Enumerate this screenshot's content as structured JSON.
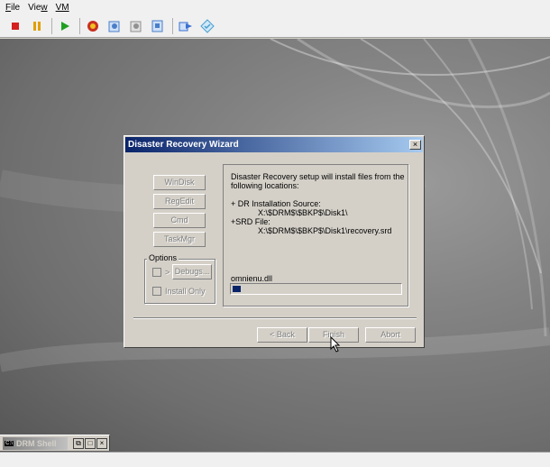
{
  "menubar": {
    "file": "File",
    "view": "View",
    "vm": "VM"
  },
  "toolbar": {
    "buttons": [
      {
        "name": "stop-icon",
        "color": "#d42020"
      },
      {
        "name": "pause-icon",
        "color": "#e0a000"
      },
      {
        "name": "play-icon",
        "color": "#20a020"
      },
      {
        "name": "reset-icon",
        "color": "#c83020"
      },
      {
        "name": "snapshot-icon",
        "color": "#4a7ec8"
      },
      {
        "name": "revert-icon",
        "color": "#909090"
      },
      {
        "name": "settings-icon",
        "color": "#4a7ec8"
      },
      {
        "name": "send-keys-icon",
        "color": "#3a6ed0"
      },
      {
        "name": "tools-icon",
        "color": "#4a9ed0"
      }
    ]
  },
  "dialog": {
    "title": "Disaster Recovery Wizard",
    "close": "×",
    "buttons": {
      "windisk": "WinDisk",
      "regedit": "RegEdit",
      "cmd": "Cmd",
      "taskmgr": "TaskMgr"
    },
    "options": {
      "label": "Options",
      "chk1_glyph": ">",
      "debugs": "Debugs...",
      "install_only": "Install Only"
    },
    "info": {
      "line1": "Disaster Recovery setup will install files from the",
      "line2": "following locations:",
      "line3": "+ DR Installation Source:",
      "line4": "X:\\$DRM$\\$BKP$\\Disk1\\",
      "line5": "+SRD File:",
      "line6": "X:\\$DRM$\\$BKP$\\Disk1\\recovery.srd",
      "current_file": "omnienu.dll"
    },
    "progress_fraction": 0.05,
    "footer": {
      "back": "< Back",
      "finish": "Finish",
      "abort": "Abort"
    }
  },
  "taskwin": {
    "title": "DRM Shell",
    "icon": "C:\\",
    "restore": "⧉",
    "maximize": "□",
    "close": "×"
  }
}
